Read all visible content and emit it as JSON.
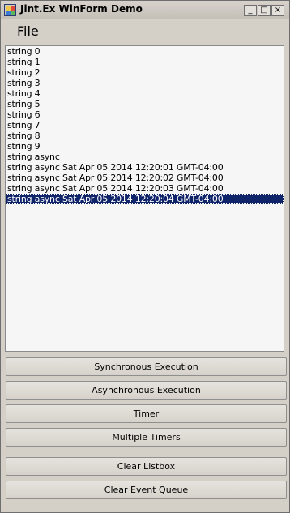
{
  "window": {
    "title": "Jint.Ex WinForm Demo",
    "minimize_glyph": "_",
    "maximize_glyph": "□",
    "close_glyph": "×"
  },
  "menu": {
    "file_label": "File"
  },
  "listbox": {
    "items": [
      "string 0",
      "string 1",
      "string 2",
      "string 3",
      "string 4",
      "string 5",
      "string 6",
      "string 7",
      "string 8",
      "string 9",
      "string async",
      "string async Sat Apr 05 2014 12:20:01 GMT-04:00",
      "string async Sat Apr 05 2014 12:20:02 GMT-04:00",
      "string async Sat Apr 05 2014 12:20:03 GMT-04:00",
      "string async Sat Apr 05 2014 12:20:04 GMT-04:00"
    ],
    "selected_index": 14
  },
  "buttons": {
    "sync": "Synchronous Execution",
    "async": "Asynchronous Execution",
    "timer": "Timer",
    "multi_timers": "Multiple Timers",
    "clear_listbox": "Clear Listbox",
    "clear_queue": "Clear Event Queue"
  },
  "colors": {
    "selection": "#10246a",
    "window_bg": "#d4d0c8"
  }
}
